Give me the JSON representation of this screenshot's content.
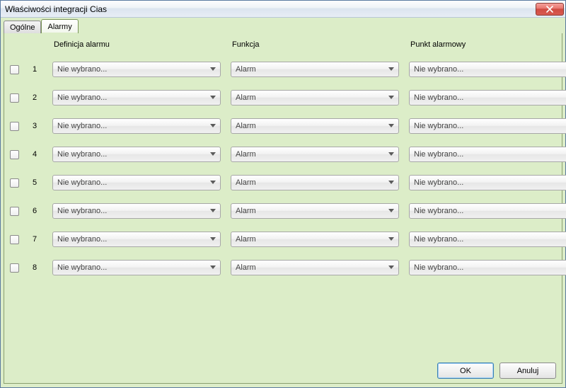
{
  "window": {
    "title": "Właściwości integracji Cias"
  },
  "tabs": {
    "general": "Ogólne",
    "alarms": "Alarmy"
  },
  "headers": {
    "definition": "Definicja alarmu",
    "function": "Funkcja",
    "point": "Punkt alarmowy"
  },
  "defaults": {
    "notSelected": "Nie wybrano...",
    "alarm": "Alarm"
  },
  "rows": [
    {
      "num": "1",
      "definition": "Nie wybrano...",
      "function": "Alarm",
      "point": "Nie wybrano..."
    },
    {
      "num": "2",
      "definition": "Nie wybrano...",
      "function": "Alarm",
      "point": "Nie wybrano..."
    },
    {
      "num": "3",
      "definition": "Nie wybrano...",
      "function": "Alarm",
      "point": "Nie wybrano..."
    },
    {
      "num": "4",
      "definition": "Nie wybrano...",
      "function": "Alarm",
      "point": "Nie wybrano..."
    },
    {
      "num": "5",
      "definition": "Nie wybrano...",
      "function": "Alarm",
      "point": "Nie wybrano..."
    },
    {
      "num": "6",
      "definition": "Nie wybrano...",
      "function": "Alarm",
      "point": "Nie wybrano..."
    },
    {
      "num": "7",
      "definition": "Nie wybrano...",
      "function": "Alarm",
      "point": "Nie wybrano..."
    },
    {
      "num": "8",
      "definition": "Nie wybrano...",
      "function": "Alarm",
      "point": "Nie wybrano..."
    }
  ],
  "buttons": {
    "ok": "OK",
    "cancel": "Anuluj"
  },
  "colors": {
    "panel_bg": "#dcedc8",
    "close_red": "#cf4b41"
  }
}
